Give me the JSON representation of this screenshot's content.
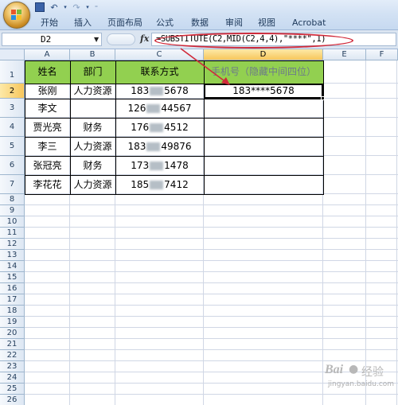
{
  "ribbon": {
    "tabs": [
      "开始",
      "插入",
      "页面布局",
      "公式",
      "数据",
      "审阅",
      "视图",
      "Acrobat"
    ],
    "icons": [
      "office-button",
      "save-icon",
      "undo-icon",
      "redo-icon",
      "customize-qat-icon"
    ]
  },
  "formula_bar": {
    "name_box": "D2",
    "fx_label": "fx",
    "formula": "=SUBSTITUTE(C2,MID(C2,4,4),\"****\",1)"
  },
  "sheet": {
    "columns": [
      "A",
      "B",
      "C",
      "D",
      "E",
      "F"
    ],
    "active_column": "D",
    "rows": [
      "1",
      "2",
      "3",
      "4",
      "5",
      "6",
      "7",
      "8",
      "9",
      "10",
      "11",
      "12",
      "13",
      "14",
      "15",
      "16",
      "17",
      "18",
      "19",
      "20",
      "21",
      "22",
      "23",
      "24",
      "25",
      "26"
    ],
    "active_row": "2",
    "header": {
      "name": "姓名",
      "dept": "部门",
      "contact": "联系方式",
      "masked": "手机号（隐藏中间四位）"
    },
    "records": [
      {
        "name": "张刚",
        "dept": "人力资源",
        "phone_prefix": "183",
        "phone_suffix": "5678",
        "masked": "183****5678"
      },
      {
        "name": "李文",
        "dept": "",
        "phone_prefix": "126",
        "phone_suffix": "44567",
        "masked": ""
      },
      {
        "name": "贾光亮",
        "dept": "财务",
        "phone_prefix": "176",
        "phone_suffix": "4512",
        "masked": ""
      },
      {
        "name": "李三",
        "dept": "人力资源",
        "phone_prefix": "183",
        "phone_suffix": "49876",
        "masked": ""
      },
      {
        "name": "张冠亮",
        "dept": "财务",
        "phone_prefix": "173",
        "phone_suffix": "1478",
        "masked": ""
      },
      {
        "name": "李花花",
        "dept": "人力资源",
        "phone_prefix": "185",
        "phone_suffix": "7412",
        "masked": ""
      }
    ],
    "header_fill": "#92d050",
    "annotation_color": "#d02a3a"
  },
  "watermark": {
    "text": "Bai",
    "suffix": "经验",
    "url": "jingyan.baidu.com"
  }
}
